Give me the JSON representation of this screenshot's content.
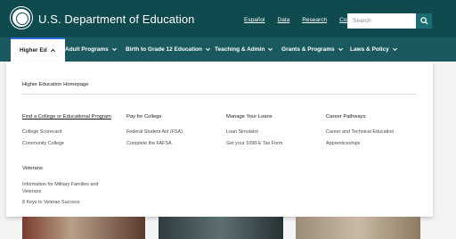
{
  "header": {
    "agency": "U.S. Department of Education",
    "utility_links": [
      "Español",
      "Data",
      "Research",
      "Contact Us"
    ],
    "search": {
      "placeholder": "Search"
    }
  },
  "nav": {
    "items": [
      {
        "label": "Higher Ed",
        "active": true
      },
      {
        "label": "Adult Programs"
      },
      {
        "label": "Birth to Grade 12 Education"
      },
      {
        "label": "Teaching & Admin"
      },
      {
        "label": "Grants & Programs"
      },
      {
        "label": "Laws & Policy"
      }
    ]
  },
  "dropdown": {
    "homepage_link": "Higher Education Homepage",
    "columns": [
      {
        "heading": "Find a College or Educational Program",
        "links": [
          "College Scorecard",
          "Community College"
        ]
      },
      {
        "heading": "Pay for College",
        "links": [
          "Federal Student Aid (FSA)",
          "Complete the FAFSA"
        ]
      },
      {
        "heading": "Manage Your Loans",
        "links": [
          "Loan Simulator",
          "Get your 1098-E Tax Form"
        ]
      },
      {
        "heading": "Career Pathways",
        "links": [
          "Career and Technical Education",
          "Apprenticeships"
        ]
      }
    ],
    "veterans": {
      "heading": "Veterans",
      "links": [
        "Information for Military Families and Veterans",
        "8 Keys to Veteran Success"
      ]
    }
  },
  "colors": {
    "header_bg": "#0f4a4f",
    "nav_bg": "#1a5a5f",
    "accent": "#2a6fdb"
  },
  "icons": [
    "seal-logo",
    "search-icon",
    "chevron-up-icon",
    "chevron-down-icon"
  ]
}
